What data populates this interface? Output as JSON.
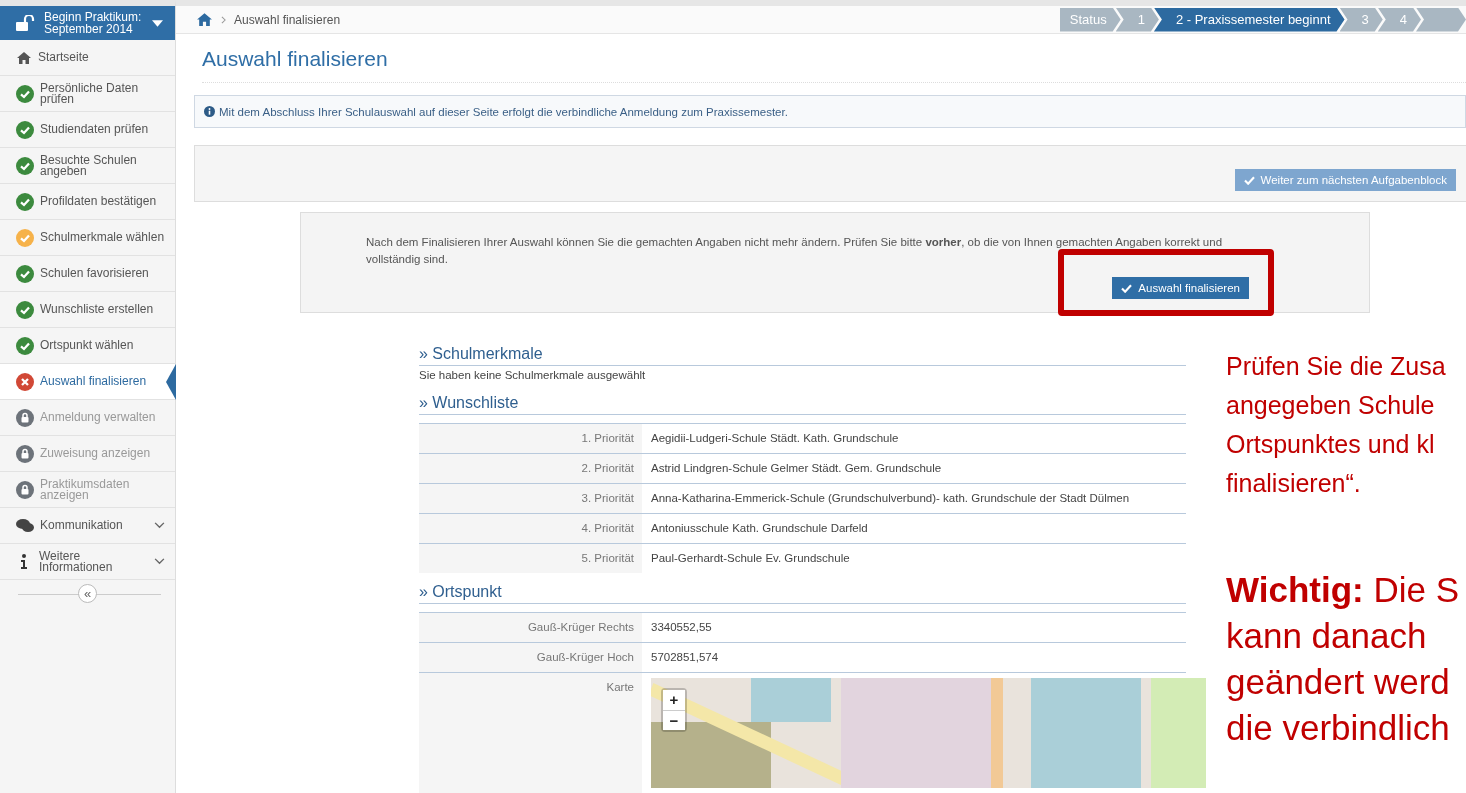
{
  "sidebar": {
    "header": {
      "title": "Beginn Praktikum: September 2014"
    },
    "items": [
      {
        "label": "Startseite",
        "kind": "home",
        "selected": false
      },
      {
        "label": "Persönliche Daten prüfen",
        "kind": "done",
        "selected": false
      },
      {
        "label": "Studiendaten prüfen",
        "kind": "done",
        "selected": false
      },
      {
        "label": "Besuchte Schulen angeben",
        "kind": "done",
        "selected": false
      },
      {
        "label": "Profildaten bestätigen",
        "kind": "done",
        "selected": false
      },
      {
        "label": "Schulmerkmale wählen",
        "kind": "partial",
        "selected": false
      },
      {
        "label": "Schulen favorisieren",
        "kind": "done",
        "selected": false
      },
      {
        "label": "Wunschliste erstellen",
        "kind": "done",
        "selected": false
      },
      {
        "label": "Ortspunkt wählen",
        "kind": "done",
        "selected": false
      },
      {
        "label": "Auswahl finalisieren",
        "kind": "error",
        "selected": true
      },
      {
        "label": "Anmeldung verwalten",
        "kind": "locked",
        "selected": false
      },
      {
        "label": "Zuweisung anzeigen",
        "kind": "locked",
        "selected": false
      },
      {
        "label": "Praktikumsdaten anzeigen",
        "kind": "locked",
        "selected": false
      },
      {
        "label": "Kommunikation",
        "kind": "chat",
        "selected": false,
        "expanded": false
      },
      {
        "label": "Weitere Informationen",
        "kind": "info",
        "selected": false,
        "expanded": false
      }
    ],
    "collapse": "«"
  },
  "breadcrumb": {
    "current": "Auswahl finalisieren"
  },
  "steps": [
    {
      "label": "Status",
      "selected": false
    },
    {
      "label": "1",
      "selected": false
    },
    {
      "label": "2 - Praxissemester beginnt",
      "selected": true
    },
    {
      "label": "3",
      "selected": false
    },
    {
      "label": "4",
      "selected": false
    }
  ],
  "page_title": "Auswahl finalisieren",
  "info_message": "Mit dem Abschluss Ihrer Schulauswahl auf dieser Seite erfolgt die verbindliche Anmeldung zum Praxissemester.",
  "next_button": "Weiter zum nächsten Aufgabenblock",
  "confirm_panel": {
    "text": "Nach dem Finalisieren Ihrer Auswahl können Sie die gemachten Angaben nicht mehr ändern. Prüfen Sie bitte **vorher**, ob die von Ihnen gemachten Angaben korrekt und vollständig sind.",
    "button": "Auswahl finalisieren"
  },
  "schulmerkmale": {
    "heading": "» Schulmerkmale",
    "empty_text": "Sie haben keine Schulmerkmale ausgewählt"
  },
  "wunschliste": {
    "heading": "» Wunschliste",
    "rows": [
      {
        "priority": "1. Priorität",
        "school": "Aegidii-Ludgeri-Schule Städt. Kath. Grundschule"
      },
      {
        "priority": "2. Priorität",
        "school": "Astrid Lindgren-Schule Gelmer Städt. Gem. Grundschule"
      },
      {
        "priority": "3. Priorität",
        "school": "Anna-Katharina-Emmerick-Schule (Grundschulverbund)- kath. Grundschule der Stadt Dülmen"
      },
      {
        "priority": "4. Priorität",
        "school": "Antoniusschule Kath. Grundschule Darfeld"
      },
      {
        "priority": "5. Priorität",
        "school": "Paul-Gerhardt-Schule Ev. Grundschule"
      }
    ]
  },
  "ortspunkt": {
    "heading": "» Ortspunkt",
    "rows": [
      {
        "label": "Gauß-Krüger Rechts",
        "value": "3340552,55"
      },
      {
        "label": "Gauß-Krüger Hoch",
        "value": "5702851,574"
      }
    ],
    "map": {
      "label": "Karte",
      "zoom_in": "+",
      "zoom_out": "−"
    }
  },
  "annotation": {
    "lines": [
      "Prüfen Sie die Zusa",
      "angegeben Schule",
      "Ortspunktes und kl",
      "finalisieren“."
    ],
    "warning_lines": [
      "**Wichtig:** Die S",
      "kann danach",
      "geändert werd",
      "die verbindlich"
    ]
  }
}
